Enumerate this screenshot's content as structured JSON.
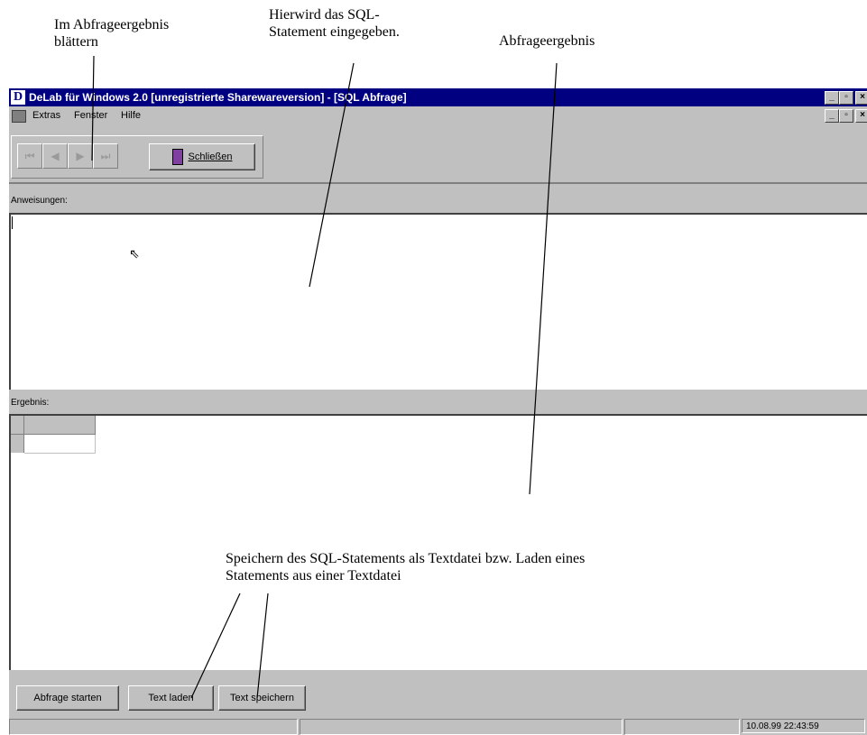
{
  "annotations": {
    "browse": "Im Abfrageergebnis\nblättern",
    "statement": "Hierwird das SQL-\nStatement eingegeben.",
    "result": "Abfrageergebnis",
    "save_load": "Speichern des SQL-Statements als Textdatei bzw. Laden eines\nStatements aus einer Textdatei"
  },
  "window": {
    "app_icon": "D",
    "title": "DeLab für Windows 2.0 [unregistrierte Sharewareversion] - [SQL Abfrage]",
    "controls": {
      "minimize": "_",
      "restore": "▫",
      "close": "×"
    }
  },
  "menu": {
    "items": [
      "Extras",
      "Fenster",
      "Hilfe"
    ]
  },
  "toolbar": {
    "nav": [
      "⏮",
      "◀",
      "▶",
      "⏭"
    ],
    "close_label": "Schließen"
  },
  "instructions": {
    "label": "Anweisungen:",
    "value": ""
  },
  "result": {
    "label": "Ergebnis:"
  },
  "buttons": {
    "start_query": "Abfrage starten",
    "load_text": "Text laden",
    "save_text": "Text speichern"
  },
  "statusbar": {
    "timestamp": "10.08.99 22:43:59"
  }
}
